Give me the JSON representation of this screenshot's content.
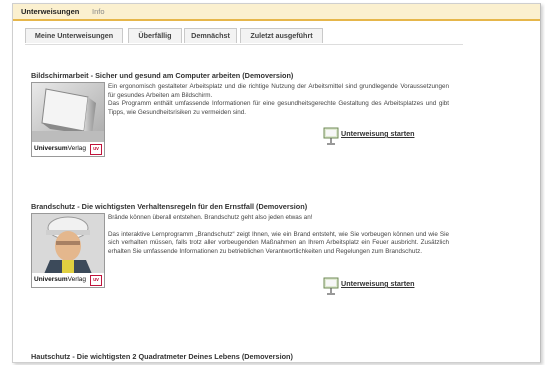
{
  "header": {
    "title": "Unterweisungen",
    "info": "Info"
  },
  "tabs": [
    {
      "label": "Meine Unterweisungen"
    },
    {
      "label": "Überfällig"
    },
    {
      "label": "Demnächst"
    },
    {
      "label": "Zuletzt ausgeführt"
    }
  ],
  "courses": [
    {
      "title": "Bildschirmarbeit - Sicher und gesund am Computer arbeiten (Demoversion)",
      "paragraphs": [
        "Ein ergonomisch gestalteter Arbeitsplatz und die richtige Nutzung der Arbeitsmittel sind grundlegende Voraussetzungen für gesundes Arbeiten am Bildschirm.",
        "Das Programm enthält umfassende Informationen für eine gesundheitsgerechte Gestaltung des Arbeitsplatzes und gibt Tipps, wie Gesundheitsrisiken zu vermeiden sind."
      ],
      "start_label": "Unterweisung starten",
      "publisher": {
        "name_bold": "Universum",
        "name_rest": "Verlag",
        "logo": "uv"
      }
    },
    {
      "title": "Brandschutz - Die wichtigsten Verhaltensregeln für den Ernstfall (Demoversion)",
      "paragraphs": [
        "Brände können überall entstehen. Brandschutz geht also jeden etwas an!",
        "Das interaktive Lernprogramm „Brandschutz“ zeigt Ihnen, wie ein Brand entsteht, wie Sie vorbeugen können und wie Sie sich verhalten müssen, falls trotz aller vorbeugenden Maßnahmen an Ihrem Arbeitsplatz ein Feuer ausbricht. Zusätzlich erhalten Sie umfassende Informationen zu betrieblichen Verantwortlichkeiten und Regelungen zum Brandschutz."
      ],
      "start_label": "Unterweisung starten",
      "publisher": {
        "name_bold": "Universum",
        "name_rest": "Verlag",
        "logo": "uv"
      }
    },
    {
      "title": "Hautschutz - Die wichtigsten 2 Quadratmeter Deines Lebens (Demoversion)"
    }
  ],
  "icons": {
    "start": "presentation-board-icon"
  },
  "colors": {
    "header_bg": "#fbf0cf",
    "header_border": "#e6b64a",
    "publisher_logo": "#c0143c"
  }
}
